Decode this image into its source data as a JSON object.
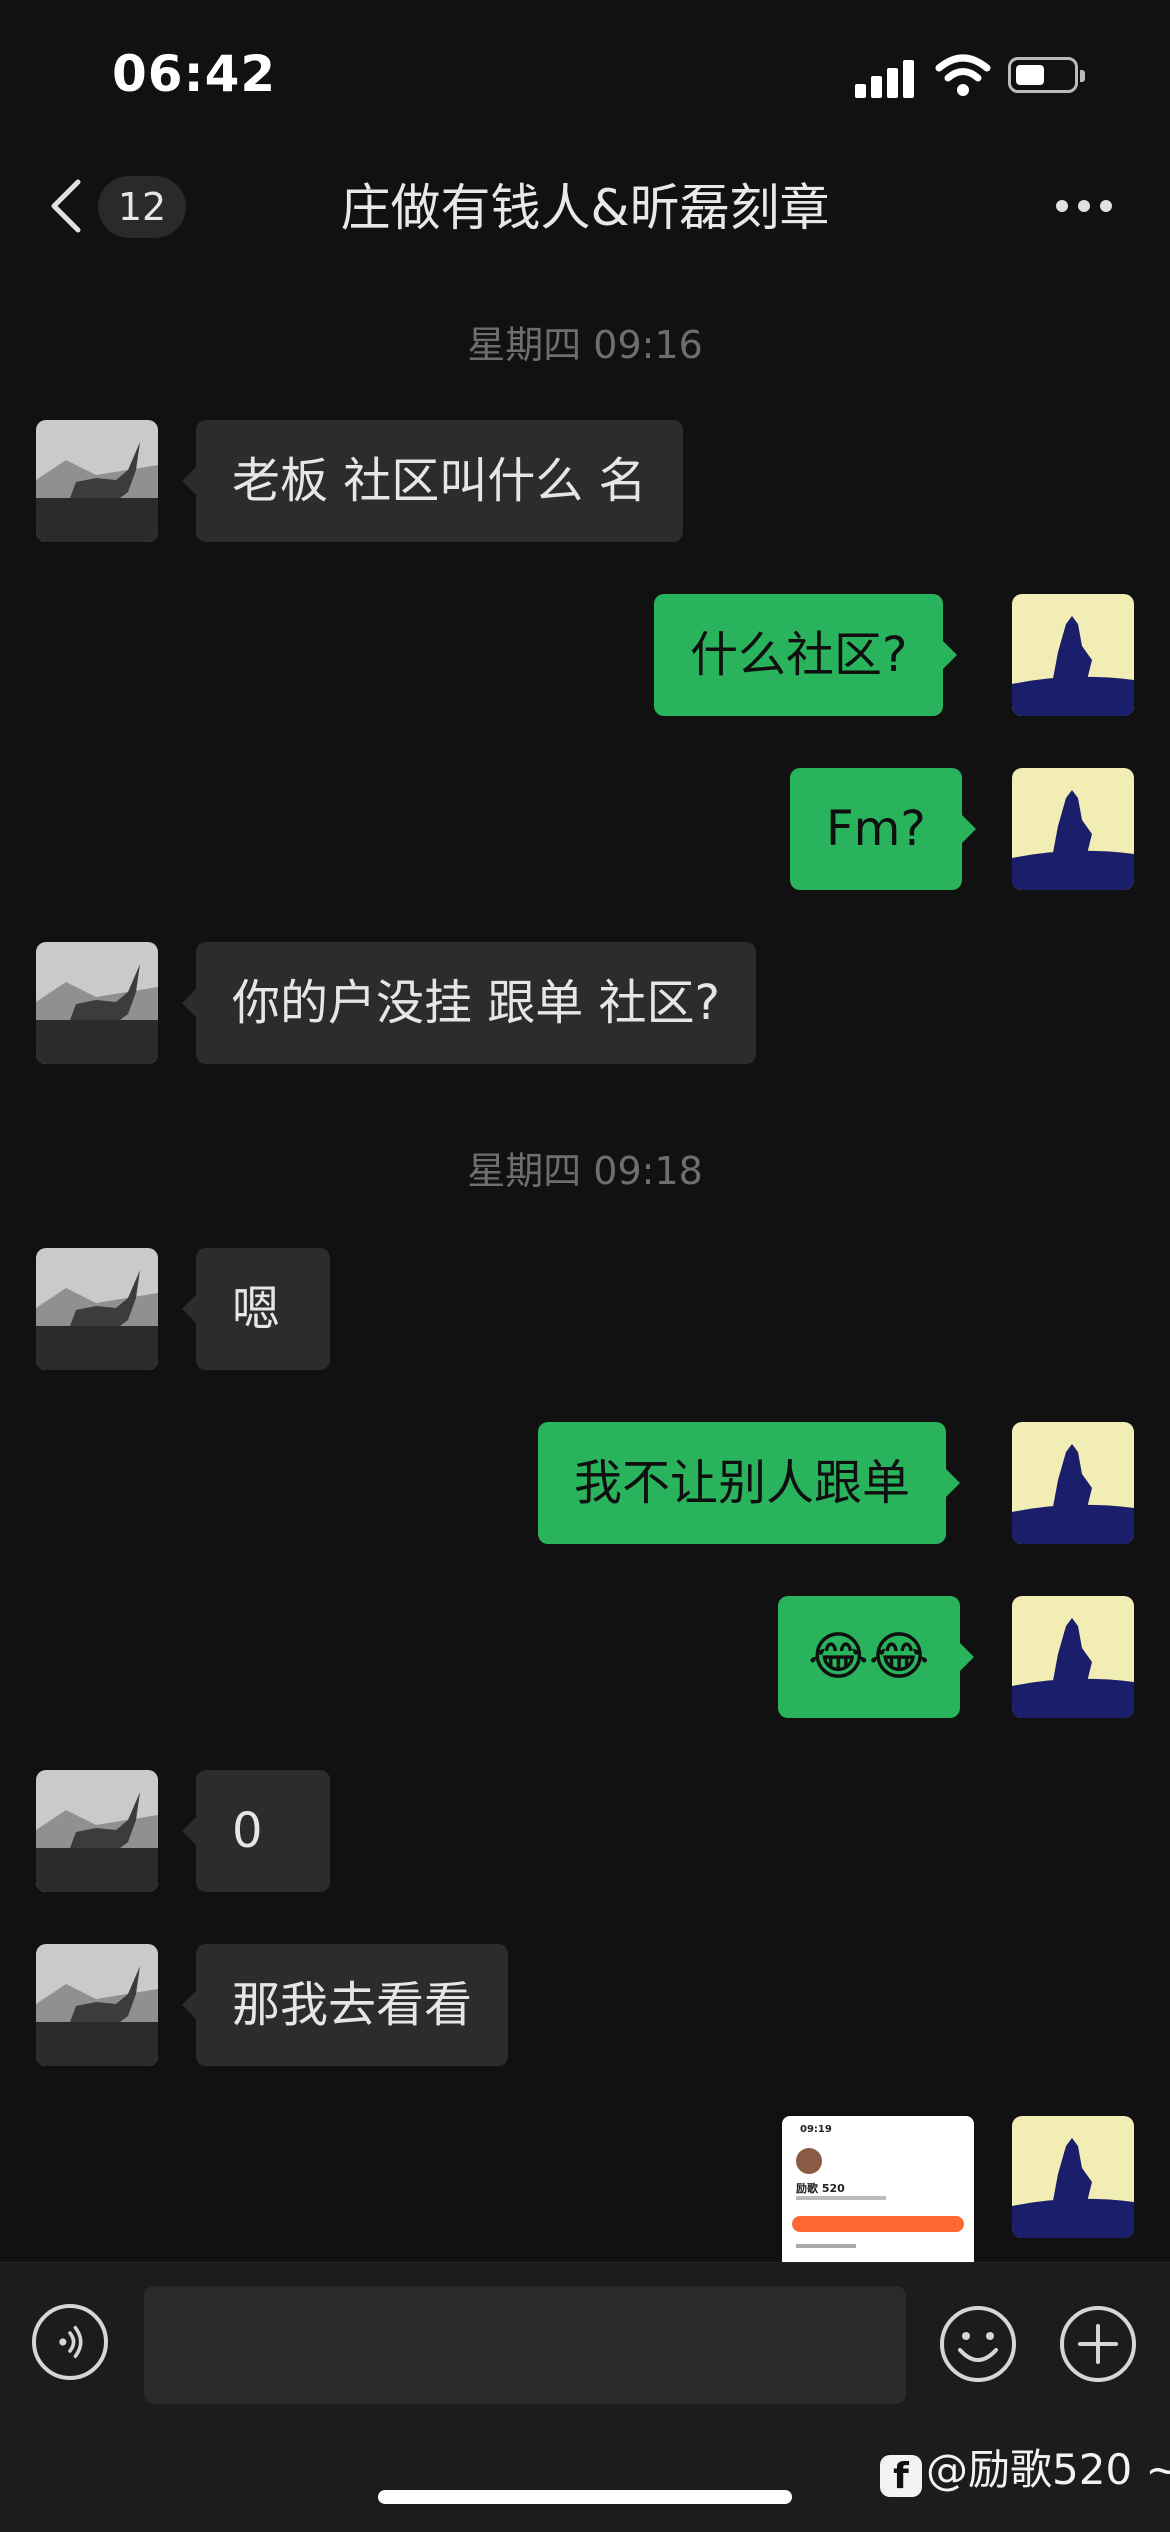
{
  "status_bar": {
    "time": "06:42"
  },
  "nav": {
    "unread_count": "12",
    "title": "庄做有钱人&昕磊刻章"
  },
  "timestamps": [
    "星期四 09:16",
    "星期四 09:18"
  ],
  "messages": [
    {
      "side": "in",
      "text": "老板  社区叫什么 名"
    },
    {
      "side": "out",
      "text": "什么社区?"
    },
    {
      "side": "out",
      "text": "Fm?"
    },
    {
      "side": "in",
      "text": "你的户没挂 跟单 社区?"
    },
    {
      "side": "in",
      "text": "嗯"
    },
    {
      "side": "out",
      "text": "我不让别人跟单"
    },
    {
      "side": "out",
      "text": "😂😂"
    },
    {
      "side": "in",
      "text": "0"
    },
    {
      "side": "in",
      "text": "那我去看看"
    }
  ],
  "image_message": {
    "time": "09:19",
    "name": "励歌 520"
  },
  "input": {
    "placeholder": ""
  },
  "watermark": "@励歌520 ~",
  "icons": {
    "back": "chevron-left-icon",
    "more": "more-dots-icon",
    "voice": "voice-icon",
    "emoji": "emoji-icon",
    "plus": "plus-icon"
  },
  "colors": {
    "background": "#111111",
    "incoming_bubble": "#2c2c2c",
    "outgoing_bubble": "#29b35c",
    "timestamp": "#6e6e6e"
  }
}
